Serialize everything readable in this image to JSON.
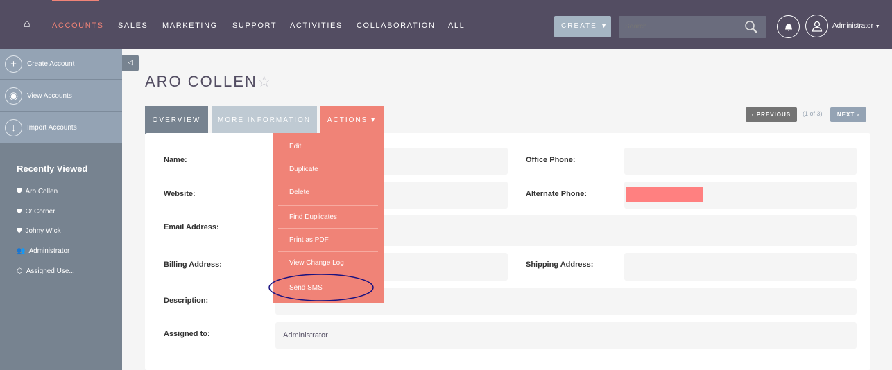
{
  "nav": {
    "items": [
      "ACCOUNTS",
      "SALES",
      "MARKETING",
      "SUPPORT",
      "ACTIVITIES",
      "COLLABORATION",
      "ALL"
    ],
    "active": "ACCOUNTS",
    "create_label": "CREATE",
    "search_placeholder": "Search...",
    "user": "Administrator"
  },
  "sidebar": {
    "actions": [
      "Create Account",
      "View Accounts",
      "Import Accounts"
    ],
    "recently_viewed_title": "Recently Viewed",
    "recent": [
      {
        "label": "Aro Collen",
        "icon": "shield"
      },
      {
        "label": "O' Corner",
        "icon": "shield"
      },
      {
        "label": "Johny Wick",
        "icon": "shield"
      },
      {
        "label": "Administrator",
        "icon": "users"
      },
      {
        "label": "Assigned Use...",
        "icon": "cube"
      }
    ]
  },
  "record": {
    "title": "ARO COLLEN",
    "tabs": [
      "OVERVIEW",
      "MORE INFORMATION",
      "ACTIONS"
    ],
    "pagination": {
      "previous": "PREVIOUS",
      "count": "(1 of 3)",
      "next": "NEXT"
    },
    "fields": {
      "name": "Name:",
      "website": "Website:",
      "email": "Email Address:",
      "billing": "Billing Address:",
      "description": "Description:",
      "assigned": "Assigned to:",
      "assigned_value": "Administrator",
      "office_phone": "Office Phone:",
      "alternate_phone": "Alternate Phone:",
      "shipping": "Shipping Address:"
    }
  },
  "actions_menu": [
    "Edit",
    "Duplicate",
    "Delete",
    "Find Duplicates",
    "Print as PDF",
    "View Change Log",
    "Send SMS"
  ],
  "colors": {
    "header": "#534d62",
    "accent": "#f08377",
    "highlight_ellipse": "#1a1280",
    "redaction": "#ff8080"
  }
}
